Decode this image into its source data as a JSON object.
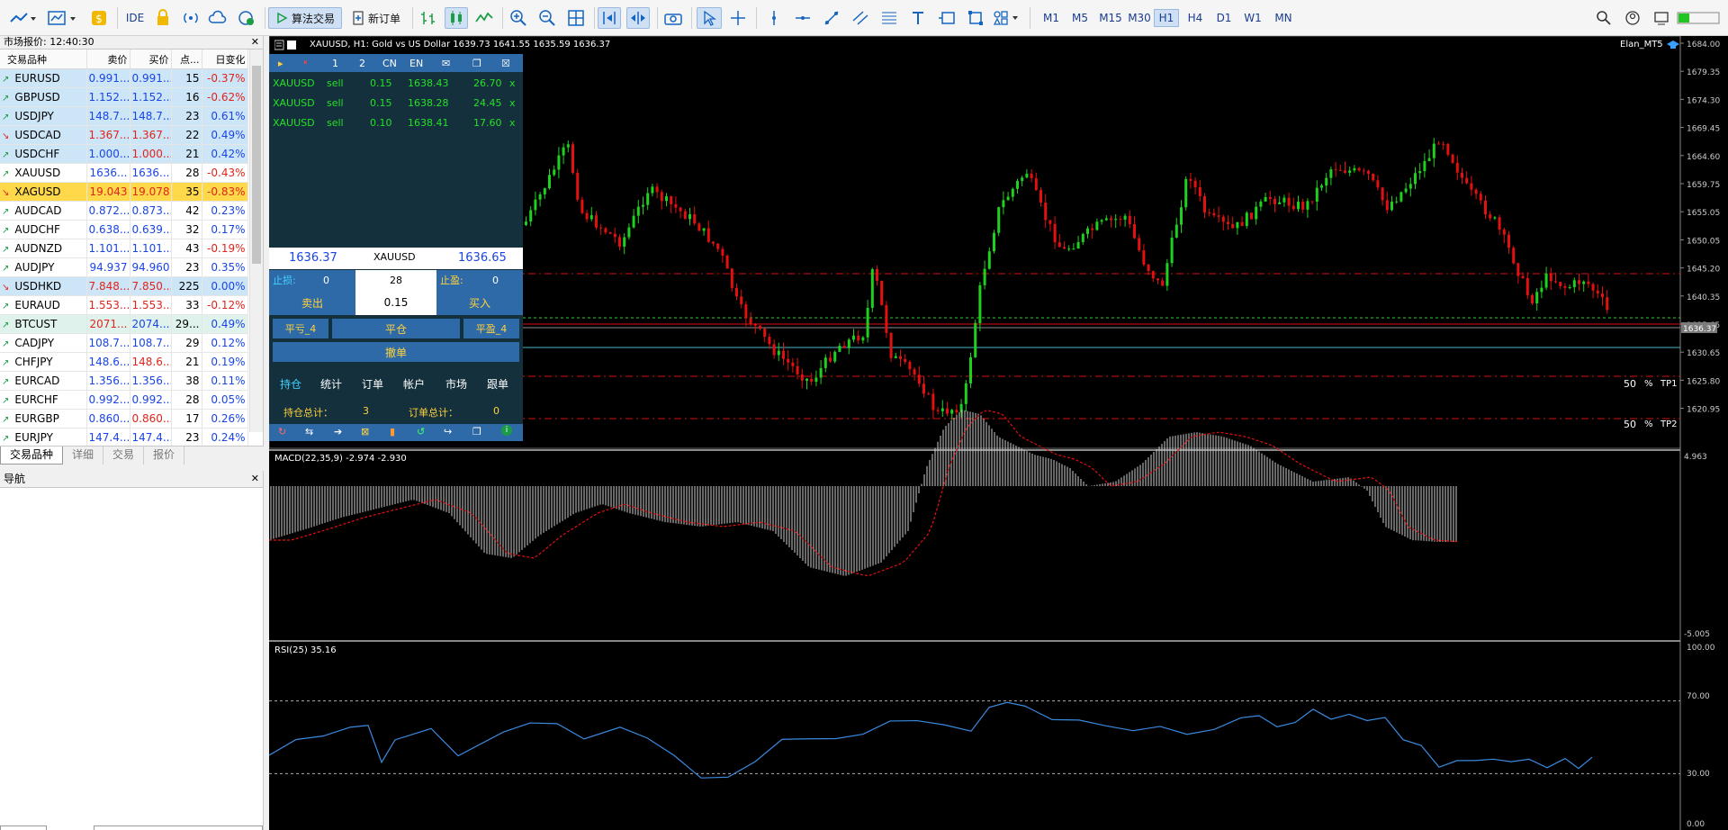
{
  "toolbar": {
    "ide": "IDE",
    "algo_trading": "算法交易",
    "new_order": "新订单",
    "timeframes": [
      "M1",
      "M5",
      "M15",
      "M30",
      "H1",
      "H4",
      "D1",
      "W1",
      "MN"
    ],
    "active_timeframe": "H1"
  },
  "market_watch": {
    "title": "市场报价: 12:40:30",
    "columns": [
      "交易品种",
      "卖价",
      "买价",
      "点...",
      "日变化"
    ],
    "rows": [
      {
        "symbol": "EURUSD",
        "bid": "0.991...",
        "ask": "0.991...",
        "spread": "15",
        "change": "-0.37%",
        "dir": "up",
        "state": "sel",
        "bidc": "up",
        "askc": "up",
        "chc": "dn"
      },
      {
        "symbol": "GBPUSD",
        "bid": "1.152...",
        "ask": "1.152...",
        "spread": "16",
        "change": "-0.62%",
        "dir": "up",
        "state": "sel",
        "bidc": "up",
        "askc": "up",
        "chc": "dn"
      },
      {
        "symbol": "USDJPY",
        "bid": "148.7...",
        "ask": "148.7...",
        "spread": "23",
        "change": "0.61%",
        "dir": "up",
        "state": "sel",
        "bidc": "up",
        "askc": "up",
        "chc": "up"
      },
      {
        "symbol": "USDCAD",
        "bid": "1.367...",
        "ask": "1.367...",
        "spread": "22",
        "change": "0.49%",
        "dir": "dn",
        "state": "sel",
        "bidc": "dn",
        "askc": "dn",
        "chc": "up"
      },
      {
        "symbol": "USDCHF",
        "bid": "1.000...",
        "ask": "1.000...",
        "spread": "21",
        "change": "0.42%",
        "dir": "up",
        "state": "sel",
        "bidc": "up",
        "askc": "dn",
        "chc": "up"
      },
      {
        "symbol": "XAUUSD",
        "bid": "1636...",
        "ask": "1636...",
        "spread": "28",
        "change": "-0.43%",
        "dir": "up",
        "state": "",
        "bidc": "up",
        "askc": "up",
        "chc": "dn"
      },
      {
        "symbol": "XAGUSD",
        "bid": "19.043",
        "ask": "19.078",
        "spread": "35",
        "change": "-0.83%",
        "dir": "dn",
        "state": "hl",
        "bidc": "dn",
        "askc": "dn",
        "chc": "dn"
      },
      {
        "symbol": "AUDCAD",
        "bid": "0.872...",
        "ask": "0.873...",
        "spread": "42",
        "change": "0.23%",
        "dir": "up",
        "state": "",
        "bidc": "up",
        "askc": "up",
        "chc": "up"
      },
      {
        "symbol": "AUDCHF",
        "bid": "0.638...",
        "ask": "0.639...",
        "spread": "32",
        "change": "0.17%",
        "dir": "up",
        "state": "",
        "bidc": "up",
        "askc": "up",
        "chc": "up"
      },
      {
        "symbol": "AUDNZD",
        "bid": "1.101...",
        "ask": "1.101...",
        "spread": "43",
        "change": "-0.19%",
        "dir": "up",
        "state": "",
        "bidc": "up",
        "askc": "up",
        "chc": "dn"
      },
      {
        "symbol": "AUDJPY",
        "bid": "94.937",
        "ask": "94.960",
        "spread": "23",
        "change": "0.35%",
        "dir": "up",
        "state": "",
        "bidc": "up",
        "askc": "up",
        "chc": "up"
      },
      {
        "symbol": "USDHKD",
        "bid": "7.848...",
        "ask": "7.850...",
        "spread": "225",
        "change": "0.00%",
        "dir": "dn",
        "state": "sel",
        "bidc": "dn",
        "askc": "dn",
        "chc": "up"
      },
      {
        "symbol": "EURAUD",
        "bid": "1.553...",
        "ask": "1.553...",
        "spread": "33",
        "change": "-0.12%",
        "dir": "up",
        "state": "",
        "bidc": "dn",
        "askc": "dn",
        "chc": "dn"
      },
      {
        "symbol": "BTCUST",
        "bid": "2071...",
        "ask": "2074...",
        "spread": "29...",
        "change": "0.49%",
        "dir": "up",
        "state": "green",
        "bidc": "dn",
        "askc": "up",
        "chc": "up"
      },
      {
        "symbol": "CADJPY",
        "bid": "108.7...",
        "ask": "108.7...",
        "spread": "29",
        "change": "0.12%",
        "dir": "up",
        "state": "",
        "bidc": "up",
        "askc": "up",
        "chc": "up"
      },
      {
        "symbol": "CHFJPY",
        "bid": "148.6...",
        "ask": "148.6...",
        "spread": "21",
        "change": "0.19%",
        "dir": "up",
        "state": "",
        "bidc": "up",
        "askc": "dn",
        "chc": "up"
      },
      {
        "symbol": "EURCAD",
        "bid": "1.356...",
        "ask": "1.356...",
        "spread": "38",
        "change": "0.11%",
        "dir": "up",
        "state": "",
        "bidc": "up",
        "askc": "up",
        "chc": "up"
      },
      {
        "symbol": "EURCHF",
        "bid": "0.992...",
        "ask": "0.992...",
        "spread": "28",
        "change": "0.05%",
        "dir": "up",
        "state": "",
        "bidc": "up",
        "askc": "up",
        "chc": "up"
      },
      {
        "symbol": "EURGBP",
        "bid": "0.860...",
        "ask": "0.860...",
        "spread": "17",
        "change": "0.26%",
        "dir": "up",
        "state": "",
        "bidc": "up",
        "askc": "dn",
        "chc": "up"
      },
      {
        "symbol": "EURJPY",
        "bid": "147.4...",
        "ask": "147.4...",
        "spread": "23",
        "change": "0.24%",
        "dir": "up",
        "state": "",
        "bidc": "up",
        "askc": "up",
        "chc": "up"
      }
    ],
    "tabs": [
      "交易品种",
      "详细",
      "交易",
      "报价"
    ],
    "active_tab": "交易品种"
  },
  "navigator": {
    "title": "导航"
  },
  "chart": {
    "header": "XAUUSD, H1:  Gold vs US Dollar   1639.73  1641.55  1635.59  1636.37",
    "ea_name": "Elan_MT5",
    "price_labels": [
      "1684.00",
      "1679.35",
      "1674.30",
      "1669.45",
      "1664.60",
      "1659.75",
      "1655.05",
      "1650.05",
      "1645.20",
      "1640.35",
      "1635.65",
      "1630.65",
      "1625.80",
      "1620.95"
    ],
    "current_price": "1636.37",
    "tp_rows": [
      {
        "pct": "50",
        "unit": "%",
        "name": "TP1"
      },
      {
        "pct": "50",
        "unit": "%",
        "name": "TP2"
      }
    ],
    "macd_label": "MACD(22,35,9) -2.974 -2.930",
    "macd_scale": [
      "4.963",
      "-5.005"
    ],
    "rsi_label": "RSI(25) 35.16",
    "rsi_scale": [
      "100.00",
      "70.00",
      "30.00",
      "0.00"
    ]
  },
  "trade_panel": {
    "head": [
      "1",
      "2",
      "CN",
      "EN"
    ],
    "orders": [
      {
        "sym": "XAUUSD",
        "type": "sell",
        "lots": "0.15",
        "price": "1638.43",
        "profit": "26.70",
        "x": "x"
      },
      {
        "sym": "XAUUSD",
        "type": "sell",
        "lots": "0.15",
        "price": "1638.28",
        "profit": "24.45",
        "x": "x"
      },
      {
        "sym": "XAUUSD",
        "type": "sell",
        "lots": "0.10",
        "price": "1638.41",
        "profit": "17.60",
        "x": "x"
      }
    ],
    "bid": "1636.37",
    "symbol": "XAUUSD",
    "ask": "1636.65",
    "sl_label": "止损:",
    "sl_value": "0",
    "spread": "28",
    "tp_label": "止盈:",
    "tp_value": "0",
    "sell": "卖出",
    "lot": "0.15",
    "buy": "买入",
    "close_loss": "平亏_4",
    "close_all": "平仓",
    "close_profit": "平盈_4",
    "cancel": "撤单",
    "tabs": [
      "持仓",
      "统计",
      "订单",
      "帐户",
      "市场",
      "跟单"
    ],
    "pos_total_label": "持仓总计：",
    "pos_total": "3",
    "ord_total_label": "订单总计：",
    "ord_total": "0"
  },
  "colors": {
    "bull": "#1fd11f",
    "bear": "#e21010",
    "panel": "#13303c",
    "rsi": "#3a8ae0",
    "macd_signal": "#e21010"
  }
}
